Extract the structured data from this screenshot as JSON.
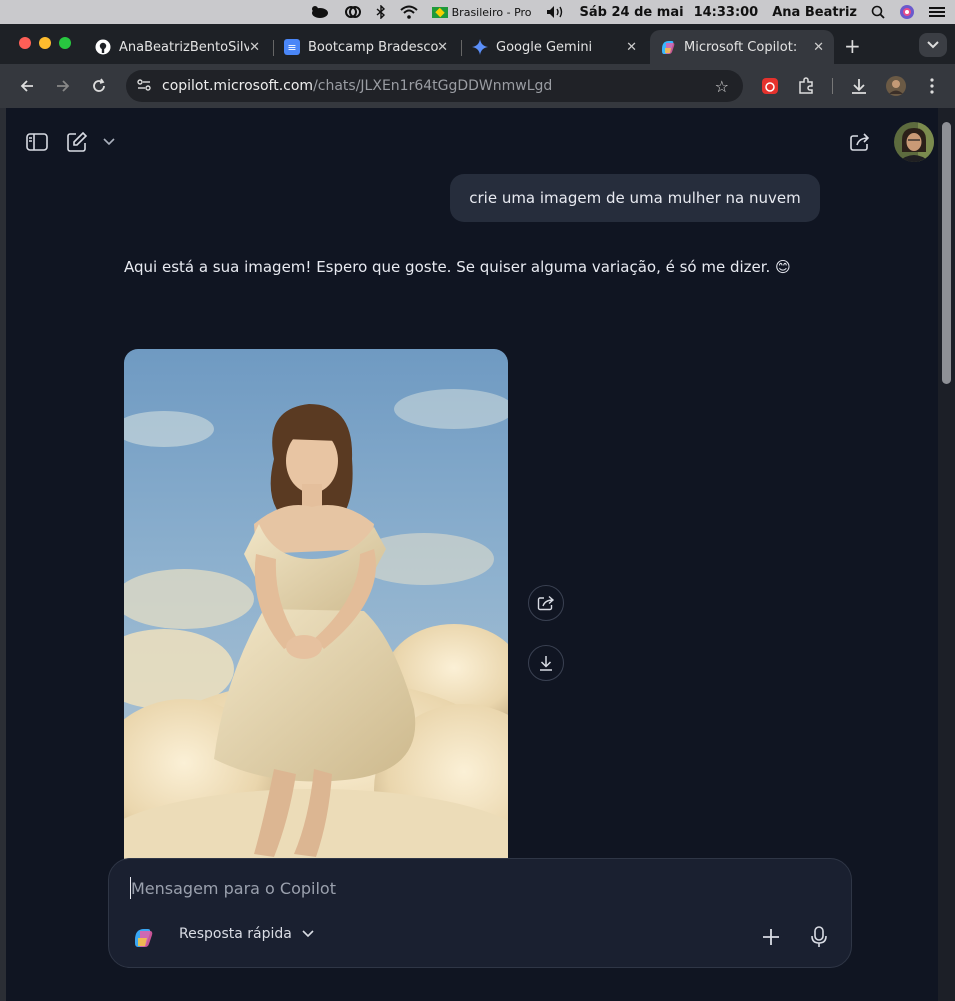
{
  "menubar": {
    "input_source": "Brasileiro - Pro",
    "datetime_day": "Sáb 24 de mai",
    "datetime_time": "14:33:00",
    "user": "Ana Beatriz"
  },
  "tabs": [
    {
      "title": "AnaBeatrizBentoSilva",
      "icon": "github-icon"
    },
    {
      "title": "Bootcamp Bradesco",
      "icon": "docs-icon"
    },
    {
      "title": "Google Gemini",
      "icon": "gemini-icon"
    },
    {
      "title": "Microsoft Copilot: se",
      "icon": "copilot-icon",
      "active": true
    }
  ],
  "address": {
    "domain": "copilot.microsoft.com",
    "path": "/chats/JLXEn1r64tGgDDWnmwLgd"
  },
  "chat": {
    "user_message": "crie uma imagem de uma mulher na nuvem",
    "assistant_message": "Aqui está a sua imagem! Espero que goste. Se quiser alguma variação, é só me dizer. 😊"
  },
  "composer": {
    "placeholder": "Mensagem para o Copilot",
    "mode_label": "Resposta rápida"
  },
  "colors": {
    "page_bg": "#101522",
    "bubble_bg": "#262d3c",
    "composer_bg": "#1a2030"
  }
}
